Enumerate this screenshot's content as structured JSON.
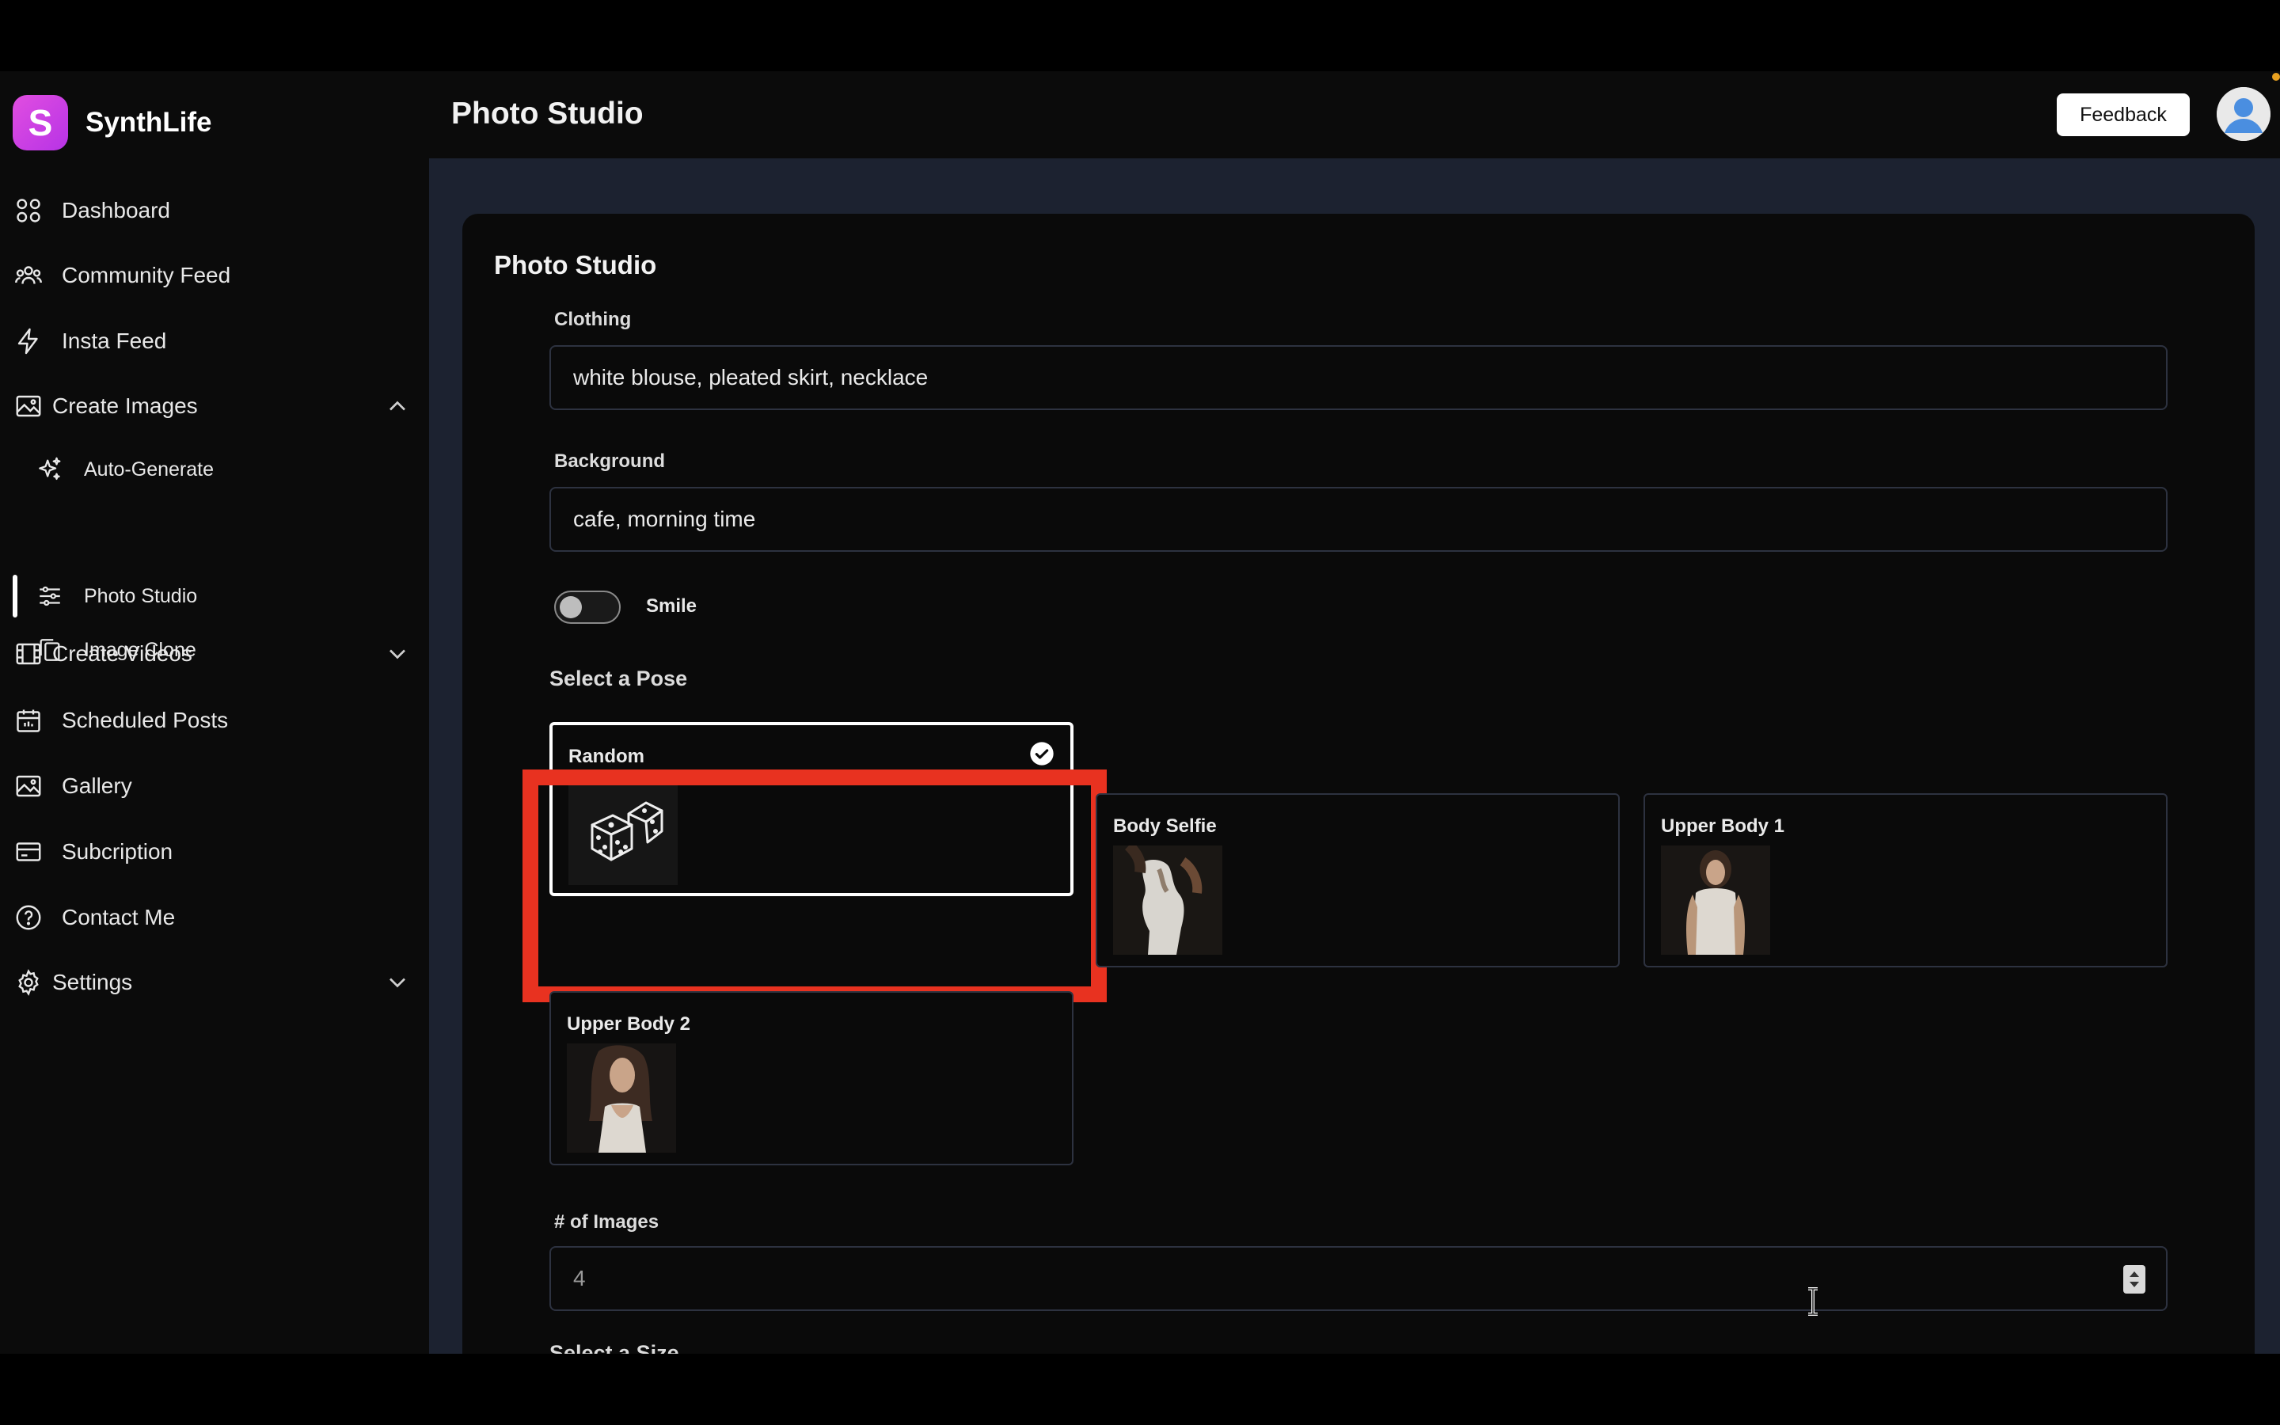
{
  "app": {
    "name": "SynthLife",
    "logo_letter": "S",
    "accent_color": "#c443e3"
  },
  "header": {
    "title": "Photo Studio",
    "feedback_label": "Feedback"
  },
  "sidebar": {
    "items": [
      {
        "label": "Dashboard",
        "icon": "grid-icon"
      },
      {
        "label": "Community Feed",
        "icon": "users-icon"
      },
      {
        "label": "Insta Feed",
        "icon": "lightning-icon"
      },
      {
        "label": "Create Images",
        "icon": "image-icon",
        "expanded": true
      },
      {
        "label": "Create Videos",
        "icon": "film-icon",
        "expanded": false
      },
      {
        "label": "Scheduled Posts",
        "icon": "calendar-icon"
      },
      {
        "label": "Gallery",
        "icon": "gallery-icon"
      },
      {
        "label": "Subcription",
        "icon": "card-icon"
      },
      {
        "label": "Contact Me",
        "icon": "help-icon"
      },
      {
        "label": "Settings",
        "icon": "gear-icon",
        "expanded": false
      }
    ],
    "create_images_sub": [
      {
        "label": "Auto-Generate",
        "icon": "sparkles-icon"
      },
      {
        "label": "Photo Studio",
        "icon": "sliders-icon",
        "active": true
      },
      {
        "label": "Image Clone",
        "icon": "copy-icon"
      }
    ]
  },
  "form": {
    "title": "Photo Studio",
    "clothing_label": "Clothing",
    "clothing_value": "white blouse, pleated skirt, necklace",
    "background_label": "Background",
    "background_value": "cafe, morning time",
    "smile_label": "Smile",
    "smile_on": false,
    "pose_title": "Select a Pose",
    "poses": [
      {
        "name": "Random",
        "selected": true
      },
      {
        "name": "Body Selfie",
        "selected": false
      },
      {
        "name": "Upper Body 1",
        "selected": false
      },
      {
        "name": "Upper Body 2",
        "selected": false
      }
    ],
    "images_label": "# of Images",
    "images_value": "4",
    "size_title": "Select a Size"
  }
}
